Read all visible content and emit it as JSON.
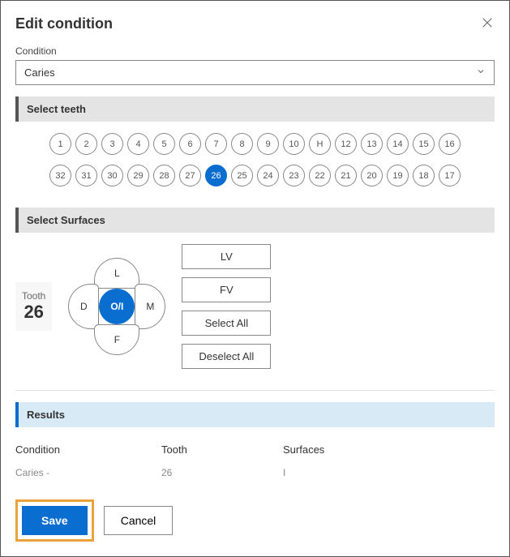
{
  "dialog": {
    "title": "Edit condition"
  },
  "condition_field": {
    "label": "Condition",
    "value": "Caries"
  },
  "sections": {
    "teeth": "Select teeth",
    "surfaces": "Select Surfaces",
    "results": "Results"
  },
  "teeth": {
    "row1": [
      "1",
      "2",
      "3",
      "4",
      "5",
      "6",
      "7",
      "8",
      "9",
      "10",
      "H",
      "12",
      "13",
      "14",
      "15",
      "16"
    ],
    "row2": [
      "32",
      "31",
      "30",
      "29",
      "28",
      "27",
      "26",
      "25",
      "24",
      "23",
      "22",
      "21",
      "20",
      "19",
      "18",
      "17"
    ],
    "selected": "26"
  },
  "tooth_indicator": {
    "label": "Tooth",
    "number": "26"
  },
  "surfaces": {
    "top": "L",
    "bottom": "F",
    "left": "D",
    "right": "M",
    "center": "O/I",
    "buttons": [
      "LV",
      "FV",
      "Select All",
      "Deselect All"
    ]
  },
  "results": {
    "headers": {
      "condition": "Condition",
      "tooth": "Tooth",
      "surfaces": "Surfaces"
    },
    "row": {
      "condition": "Caries -",
      "tooth": "26",
      "surfaces": "I"
    }
  },
  "actions": {
    "save": "Save",
    "cancel": "Cancel"
  }
}
